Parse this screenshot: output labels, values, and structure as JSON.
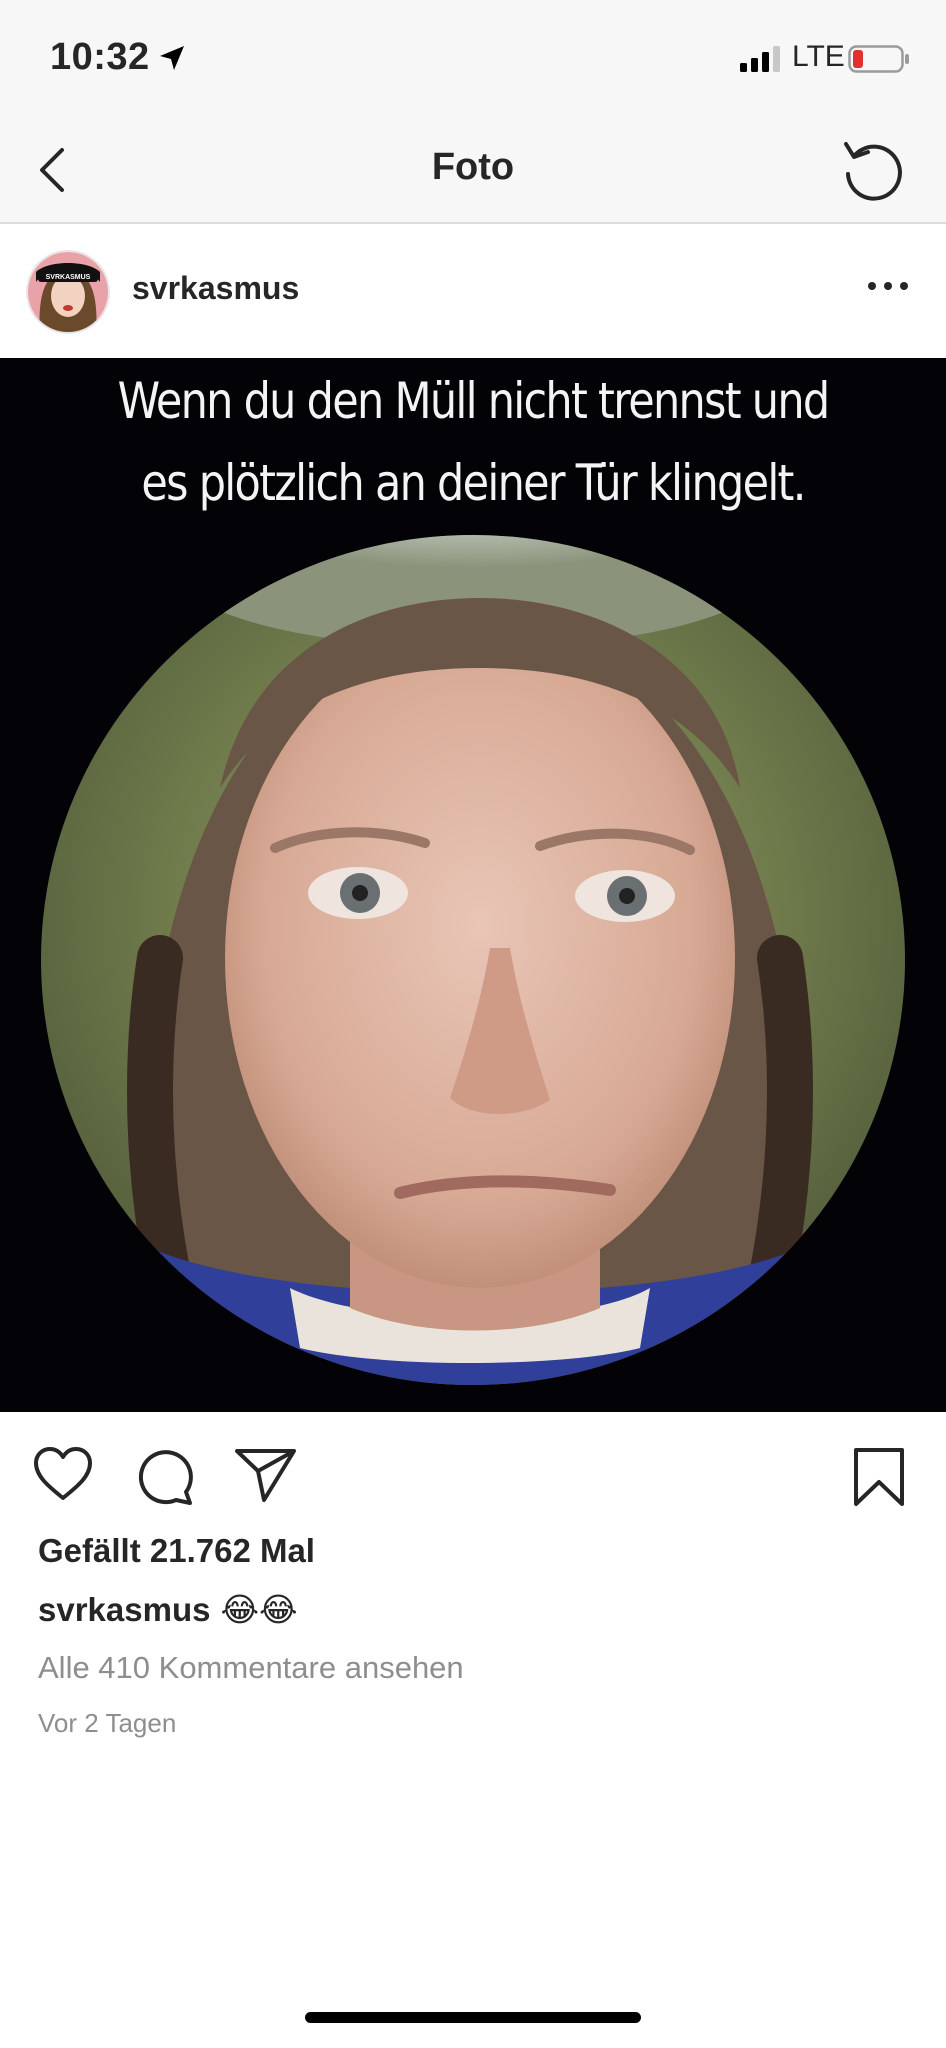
{
  "status_bar": {
    "time": "10:32",
    "network": "LTE",
    "icons": [
      "location-arrow-icon",
      "signal-bars-icon",
      "battery-low-icon"
    ]
  },
  "nav": {
    "title": "Foto",
    "back_icon": "chevron-left-icon",
    "refresh_icon": "refresh-icon"
  },
  "post": {
    "username": "svrkasmus",
    "avatar_text": "SVRKASMUS",
    "more_icon": "more-horizontal-icon",
    "image_caption_line1": "Wenn du den Müll nicht trennst und",
    "image_caption_line2": "es plötzlich an deiner Tür klingelt."
  },
  "actions": {
    "icons": [
      "heart-icon",
      "comment-icon",
      "share-icon",
      "bookmark-icon"
    ]
  },
  "meta": {
    "likes": "Gefällt 21.762 Mal",
    "caption_user": "svrkasmus",
    "caption_text": "😂😂",
    "view_comments": "Alle 410 Kommentare ansehen",
    "timestamp": "Vor 2 Tagen"
  },
  "colors": {
    "text": "#262626",
    "secondary_text": "#8e8e8e",
    "bar_background": "#f7f7f7",
    "battery_red": "#e0312b"
  }
}
